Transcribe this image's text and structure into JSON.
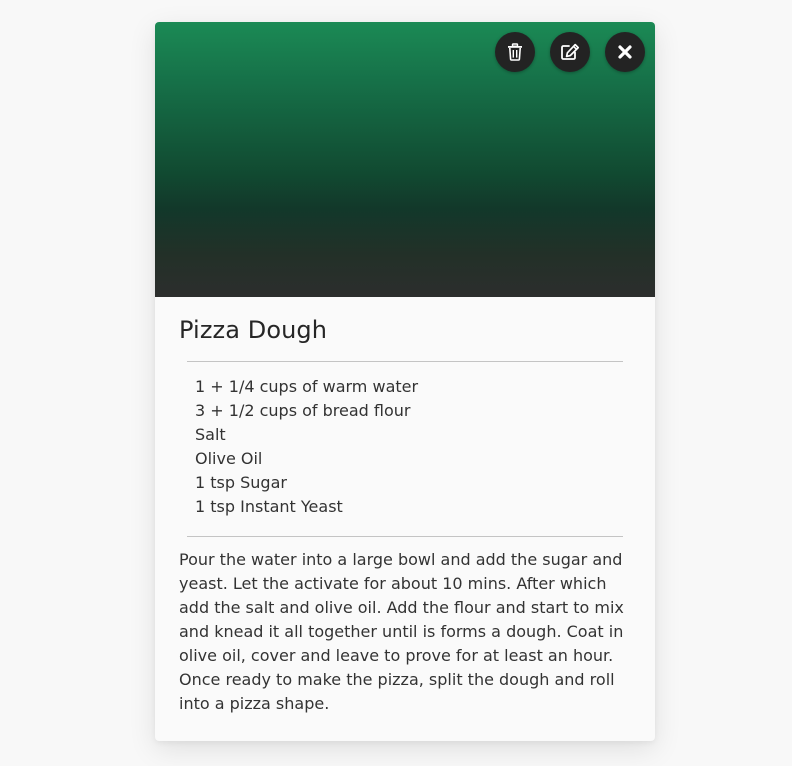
{
  "recipe": {
    "title": "Pizza Dough",
    "ingredients": [
      "1 + 1/4 cups of warm water",
      "3 + 1/2 cups of bread flour",
      "Salt",
      "Olive Oil",
      "1 tsp Sugar",
      "1 tsp Instant Yeast"
    ],
    "method": "Pour the water into a large bowl and add the sugar and yeast. Let the activate for about 10 mins. After which add the salt and olive oil. Add the flour and start to mix and knead it all together until is forms a dough. Coat in olive oil, cover and leave to prove for at least an hour. Once ready to make the pizza, split the dough and roll into a pizza shape."
  },
  "actions": {
    "delete_icon": "trash-icon",
    "edit_icon": "edit-icon",
    "close_icon": "close-icon"
  },
  "colors": {
    "hero_top": "#1b8a55",
    "hero_mid": "#12382a",
    "hero_bottom": "#2c2e2d",
    "button_bg": "#232323",
    "text": "#333333",
    "card_bg": "#fafafa",
    "page_bg": "#f8f8f8"
  }
}
